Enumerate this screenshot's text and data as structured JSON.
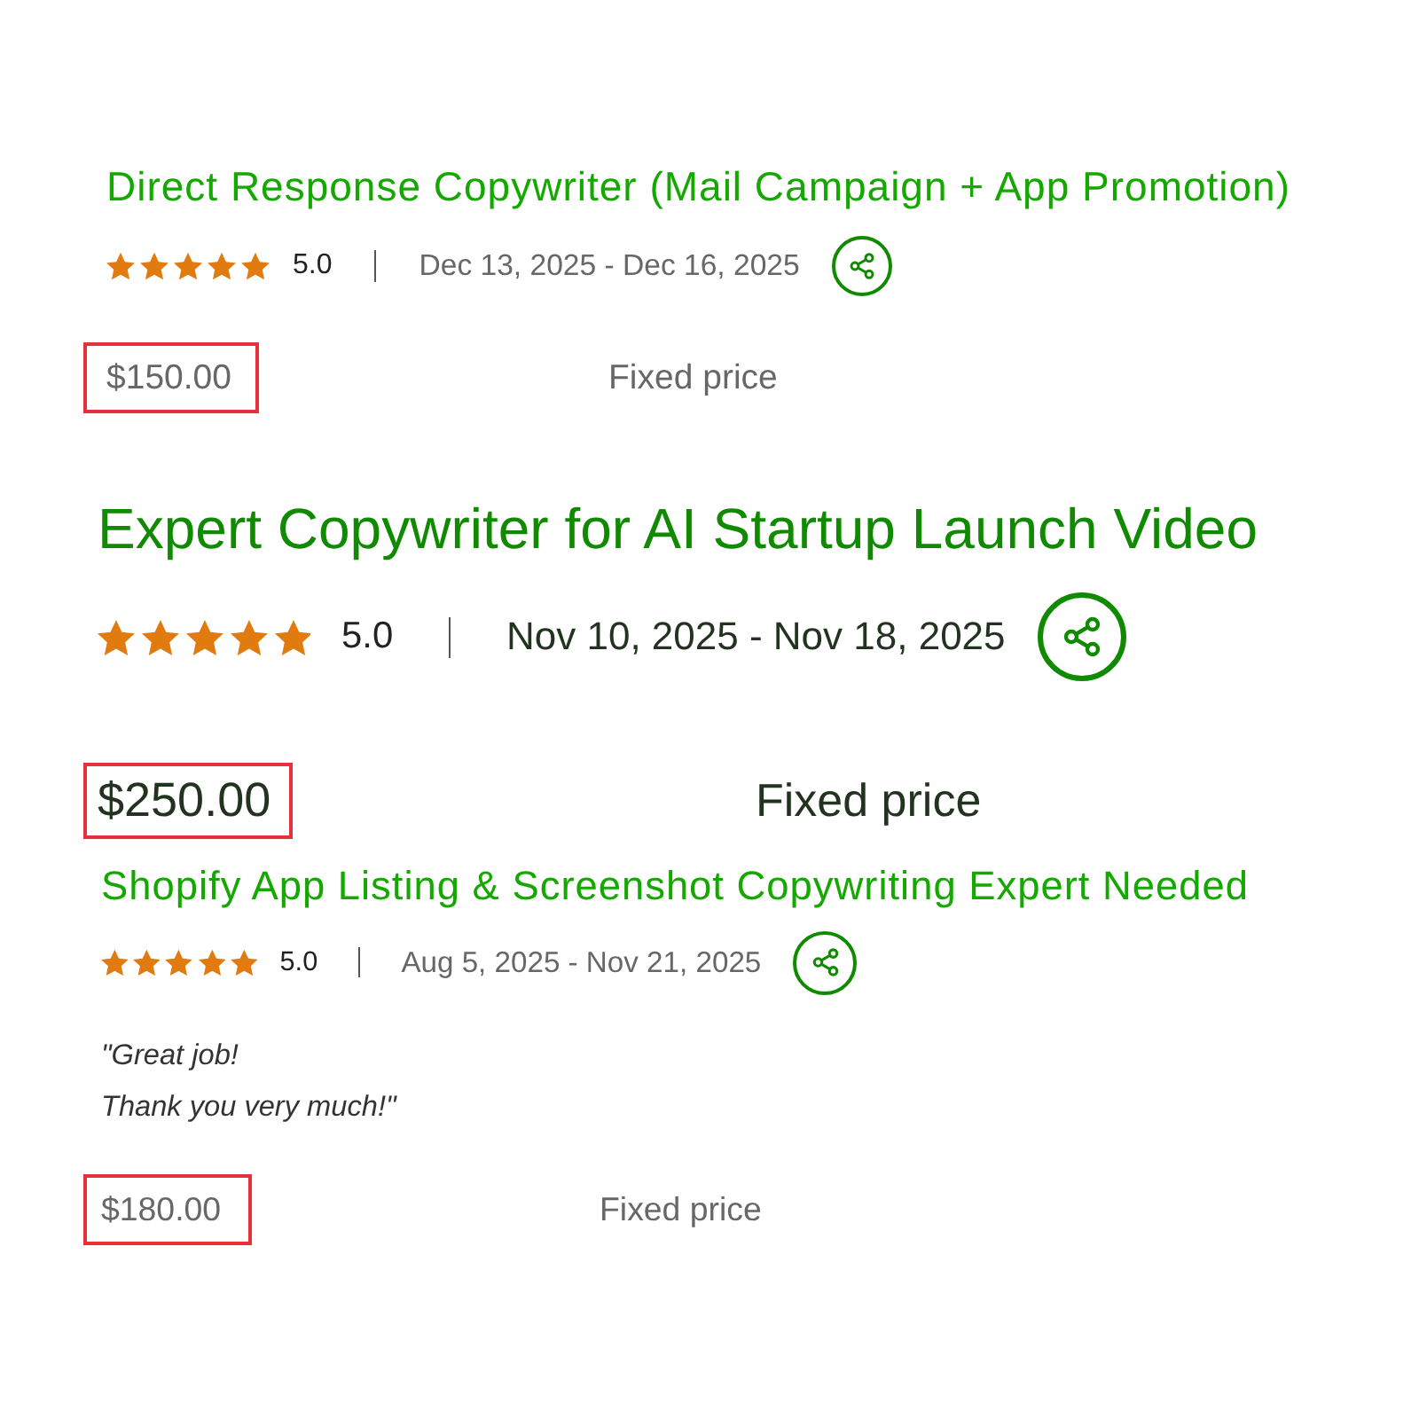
{
  "jobs": [
    {
      "title": "Direct Response Copywriter (Mail Campaign + App Promotion)",
      "stars": 5,
      "rating": "5.0",
      "dates": "Dec 13, 2025 - Dec 16, 2025",
      "price": "$150.00",
      "price_highlighted": true,
      "price_type": "Fixed price"
    },
    {
      "title": "Expert Copywriter for AI Startup Launch Video",
      "stars": 5,
      "rating": "5.0",
      "dates": "Nov 10, 2025 - Nov 18, 2025",
      "price": "$250.00",
      "price_highlighted": true,
      "price_type": "Fixed price"
    },
    {
      "title": "Shopify App Listing & Screenshot Copywriting Expert Needed",
      "stars": 5,
      "rating": "5.0",
      "dates": "Aug 5, 2025 - Nov 21, 2025",
      "review": "\"Great job!\nThank you very much!\"",
      "price": "$180.00",
      "price_highlighted": true,
      "price_type": "Fixed price"
    }
  ]
}
